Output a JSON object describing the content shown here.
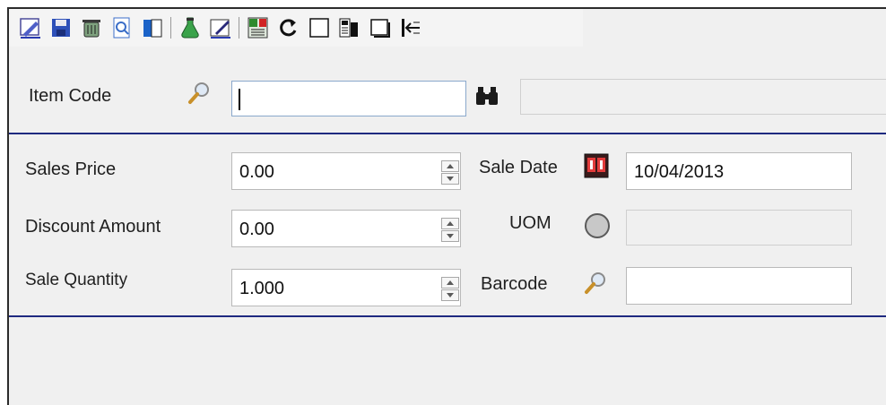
{
  "toolbar": {
    "buttons": [
      {
        "icon": "edit-icon"
      },
      {
        "icon": "save-icon"
      },
      {
        "icon": "delete-icon"
      },
      {
        "icon": "preview-icon"
      },
      {
        "icon": "columns-icon"
      },
      {
        "icon": "flask-icon"
      },
      {
        "icon": "pen-icon"
      },
      {
        "icon": "formula-icon"
      },
      {
        "icon": "refresh-icon"
      },
      {
        "icon": "blank-icon"
      },
      {
        "icon": "report-icon"
      },
      {
        "icon": "window-icon"
      },
      {
        "icon": "exit-icon"
      }
    ]
  },
  "header": {
    "item_code_label": "Item Code",
    "item_code_value": "",
    "item_description_value": ""
  },
  "form": {
    "sales_price_label": "Sales Price",
    "sales_price_value": "0.00",
    "discount_amount_label": "Discount Amount",
    "discount_amount_value": "0.00",
    "sale_quantity_label": "Sale Quantity",
    "sale_quantity_value": "1.000",
    "sale_date_label": "Sale Date",
    "sale_date_value": "10/04/2013",
    "uom_label": "UOM",
    "uom_value": "",
    "barcode_label": "Barcode",
    "barcode_value": ""
  },
  "colors": {
    "divider": "#1f2a80",
    "window_bg": "#f0f0f0"
  }
}
